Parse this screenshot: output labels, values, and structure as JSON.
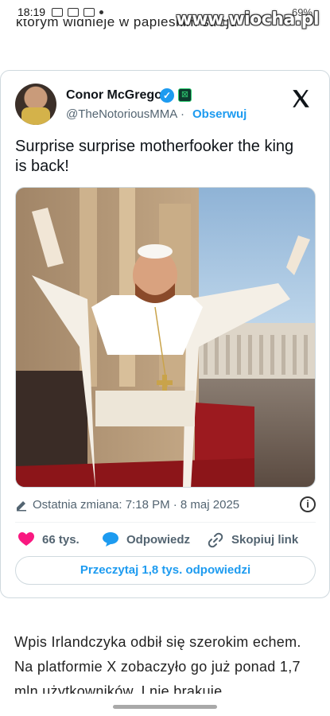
{
  "status_bar": {
    "time": "18:19",
    "battery": "69%"
  },
  "watermark": "www.wiocha.pl",
  "article": {
    "top_fragment": "którym widnieje w papieskim stroju",
    "body": "Wpis Irlandczyka odbił się szerokim echem. Na platformie X zobaczyło go już ponad 1,7 mln użytkowników. I nie brakuje"
  },
  "tweet": {
    "author_name": "Conor McGregor",
    "author_handle": "@TheNotoriousMMA",
    "separator": "·",
    "follow_label": "Obserwuj",
    "text": "Surprise surprise motherfooker the king is back!",
    "image_alt": "Conor McGregor as the Pope on a balcony",
    "last_edit": "Ostatnia zmiana: 7:18 PM · 8 maj 2025",
    "likes": "66 tys.",
    "reply_label": "Odpowiedz",
    "copy_link_label": "Skopiuj link",
    "read_replies_label": "Przeczytaj 1,8 tys. odpowiedzi",
    "info_label": "i"
  },
  "icons": {
    "verified": "verified-badge-icon",
    "affiliate": "affiliate-badge-icon",
    "brand": "x-logo-icon",
    "edit": "pencil-icon",
    "info": "info-icon",
    "like": "heart-icon",
    "reply": "speech-bubble-icon",
    "link": "link-icon"
  },
  "colors": {
    "accent": "#1d9bf0",
    "like": "#f91880",
    "text": "#0f1419",
    "muted": "#536471"
  }
}
